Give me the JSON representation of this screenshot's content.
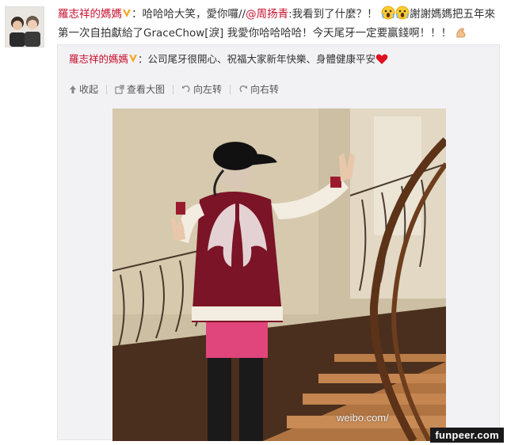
{
  "post": {
    "author": "羅志祥的媽媽",
    "colon": "：",
    "text_part1": "哈哈哈大笑，愛你囉//",
    "mention": "@周扬青",
    "text_part2": ":我看到了什麼？！",
    "text_part3": "謝謝媽媽把五年來",
    "text_line2": "第一次自拍獻給了GraceChow[淚] 我愛你哈哈哈哈！今天尾牙一定要赢錢啊！！！"
  },
  "repost": {
    "author": "羅志祥的媽媽",
    "text": "：公司尾牙很開心、祝福大家新年快樂、身體健康平安"
  },
  "toolbar": {
    "collapse": "收起",
    "view_large": "查看大图",
    "rotate_left": "向左转",
    "rotate_right": "向右转"
  },
  "watermarks": {
    "weibo": "weibo.com/",
    "site": "funpeer.com"
  },
  "colors": {
    "link": "#c8102e",
    "repost_bg": "#f2f2f5",
    "vbadge": "#f5a623"
  },
  "icons": [
    "v-badge-icon",
    "scream-emoji-icon",
    "heart-icon",
    "muscle-emoji-icon",
    "collapse-arrow-icon",
    "view-large-icon",
    "rotate-left-icon",
    "rotate-right-icon"
  ]
}
